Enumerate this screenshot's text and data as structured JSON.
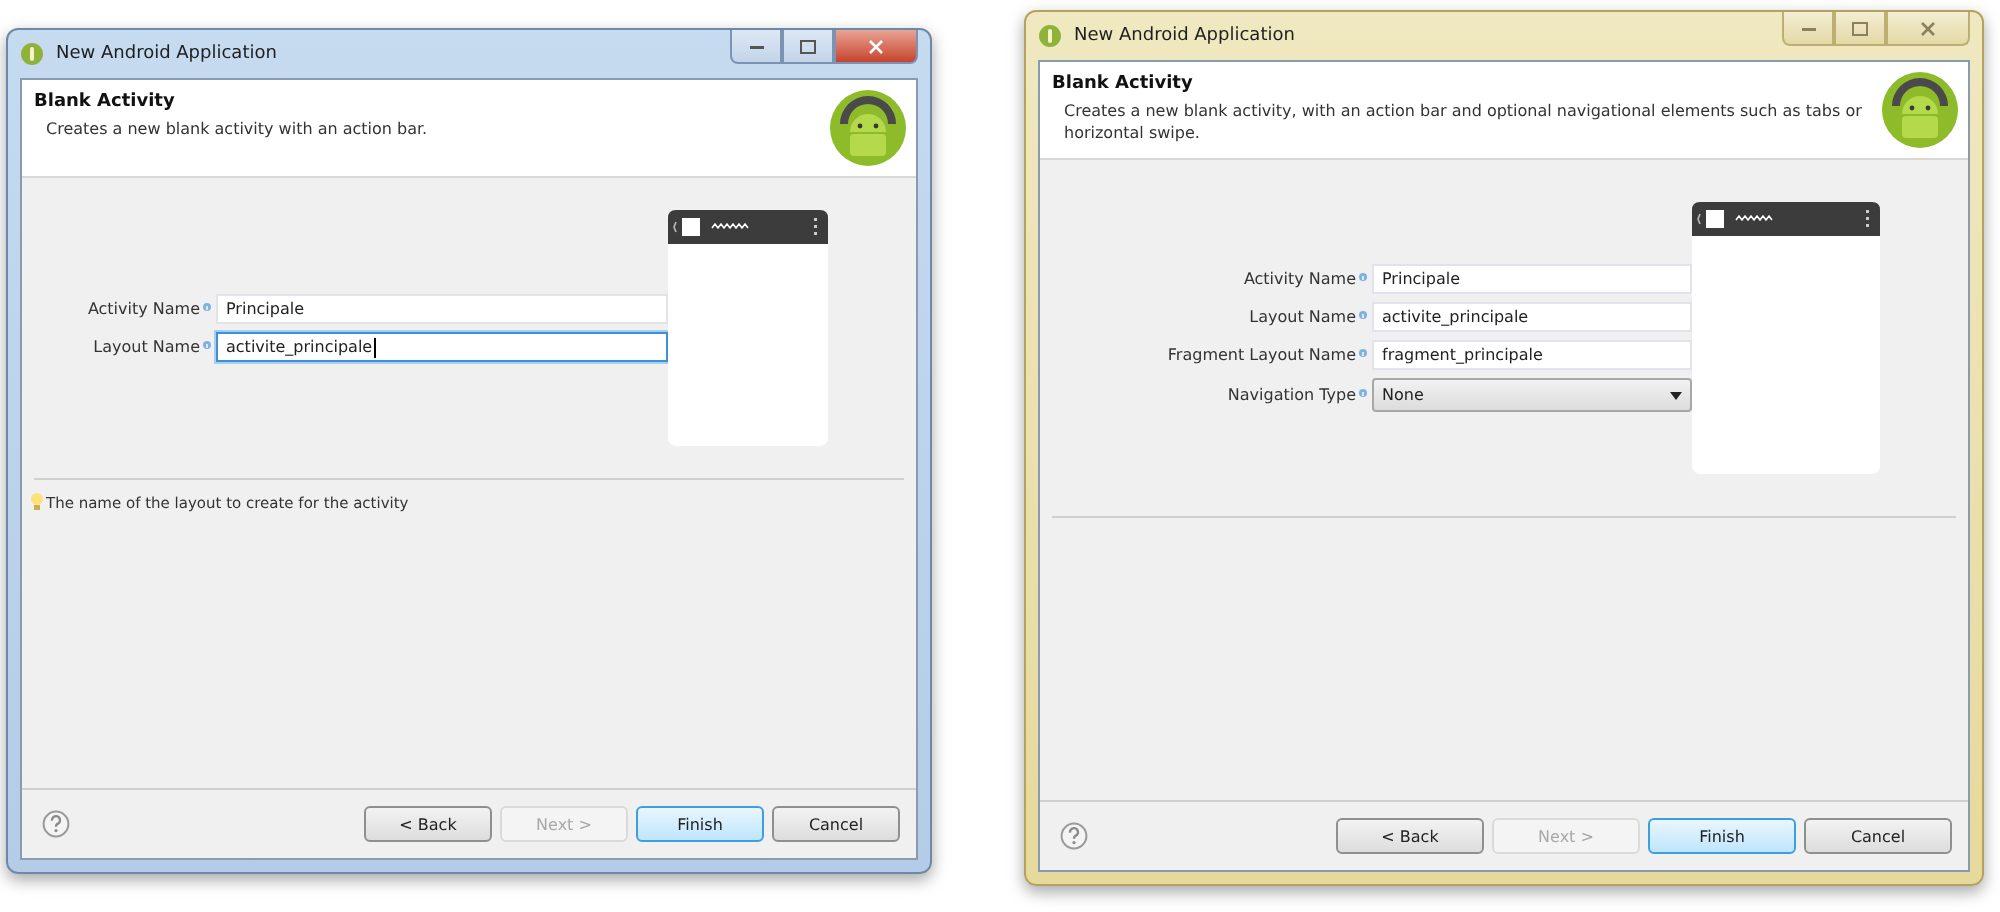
{
  "windows": [
    {
      "title": "New Android Application",
      "active": true,
      "heading": "Blank Activity",
      "description": "Creates a new blank activity with an action bar.",
      "fields": [
        {
          "kind": "text",
          "label": "Activity Name",
          "value": "Principale",
          "focused": false
        },
        {
          "kind": "text",
          "label": "Layout Name",
          "value": "activite_principale",
          "focused": true
        }
      ],
      "hint": "The name of the layout to create for the activity",
      "buttons": [
        {
          "label": "< Back",
          "disabled": false,
          "default": false
        },
        {
          "label": "Next >",
          "disabled": true,
          "default": false
        },
        {
          "label": "Finish",
          "disabled": false,
          "default": true
        },
        {
          "label": "Cancel",
          "disabled": false,
          "default": false
        }
      ]
    },
    {
      "title": "New Android Application",
      "active": false,
      "heading": "Blank Activity",
      "description": "Creates a new blank activity, with an action bar and optional navigational elements such as tabs or horizontal swipe.",
      "fields": [
        {
          "kind": "text",
          "label": "Activity Name",
          "value": "Principale",
          "focused": false
        },
        {
          "kind": "text",
          "label": "Layout Name",
          "value": "activite_principale",
          "focused": false
        },
        {
          "kind": "text",
          "label": "Fragment Layout Name",
          "value": "fragment_principale",
          "focused": false
        },
        {
          "kind": "dropdown",
          "label": "Navigation Type",
          "value": "None"
        }
      ],
      "buttons": [
        {
          "label": "< Back",
          "disabled": false,
          "default": false
        },
        {
          "label": "Next >",
          "disabled": true,
          "default": false
        },
        {
          "label": "Finish",
          "disabled": false,
          "default": true
        },
        {
          "label": "Cancel",
          "disabled": false,
          "default": false
        }
      ]
    }
  ]
}
